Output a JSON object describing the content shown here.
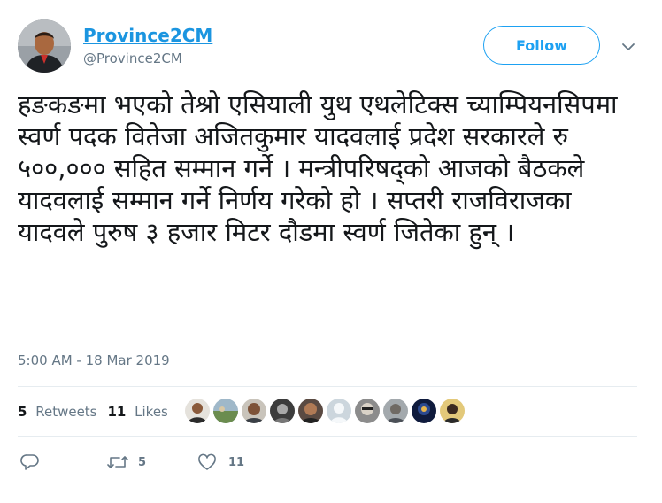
{
  "user": {
    "name": "Province2CM",
    "handle": "@Province2CM"
  },
  "follow_label": "Follow",
  "caret_icon": "chevron-down-icon",
  "tweet_text": "हङकङमा भएको तेश्रो एसियाली युथ एथलेटिक्स च्याम्पियनसिपमा स्वर्ण पदक वितेजा अजितकुमार यादवलाई प्रदेश सरकारले रु ५००,००० सहित सम्मान गर्ने । मन्त्रीपरिषद्को आजको बैठकले यादवलाई सम्मान गर्ने निर्णय गरेको हो । सप्तरी राजविराजका यादवले पुरुष ३ हजार मिटर दौडमा स्वर्ण जितेका हुन् ।",
  "timestamp": "5:00 AM - 18 Mar 2019",
  "stats": {
    "retweets_count": "5",
    "retweets_label": "Retweets",
    "likes_count": "11",
    "likes_label": "Likes"
  },
  "actions": {
    "reply_icon": "reply-icon",
    "retweet_icon": "retweet-icon",
    "retweet_count": "5",
    "like_icon": "heart-icon",
    "like_count": "11"
  },
  "colors": {
    "link": "#1b95e0",
    "accent": "#1da1f2",
    "muted": "#657786",
    "text": "#14171a",
    "divider": "#e6ecf0"
  }
}
